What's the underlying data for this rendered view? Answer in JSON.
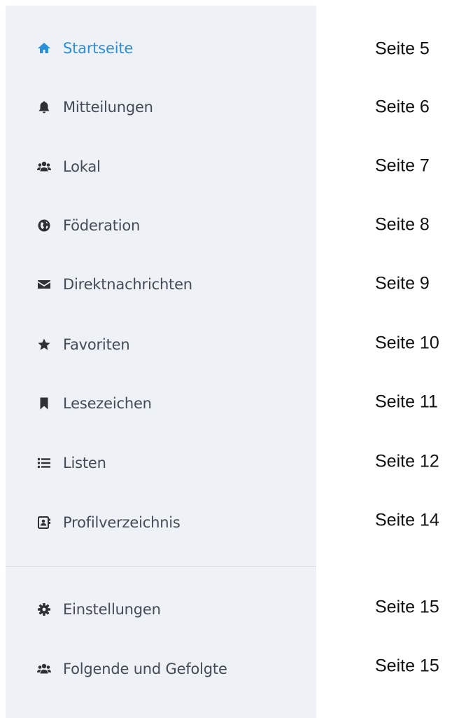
{
  "sidebar": {
    "items": [
      {
        "label": "Startseite",
        "icon": "home-icon",
        "page": "Seite 5",
        "active": true
      },
      {
        "label": "Mitteilungen",
        "icon": "bell-icon",
        "page": "Seite 6"
      },
      {
        "label": "Lokal",
        "icon": "users-icon",
        "page": "Seite 7"
      },
      {
        "label": "Föderation",
        "icon": "globe-icon",
        "page": "Seite 8"
      },
      {
        "label": "Direktnachrichten",
        "icon": "envelope-icon",
        "page": "Seite 9"
      },
      {
        "label": "Favoriten",
        "icon": "star-icon",
        "page": "Seite 10"
      },
      {
        "label": "Lesezeichen",
        "icon": "bookmark-icon",
        "page": "Seite 11"
      },
      {
        "label": "Listen",
        "icon": "list-icon",
        "page": "Seite 12"
      },
      {
        "label": "Profilverzeichnis",
        "icon": "address-book-icon",
        "page": "Seite 14"
      }
    ],
    "secondary_items": [
      {
        "label": "Einstellungen",
        "icon": "gear-icon",
        "page": "Seite 15"
      },
      {
        "label": "Folgende und Gefolgte",
        "icon": "users-icon",
        "page": "Seite 15"
      }
    ]
  },
  "colors": {
    "sidebar_bg": "#eef1f5",
    "active": "#2b90d9",
    "text": "#444b55",
    "icon": "#2d3136"
  }
}
